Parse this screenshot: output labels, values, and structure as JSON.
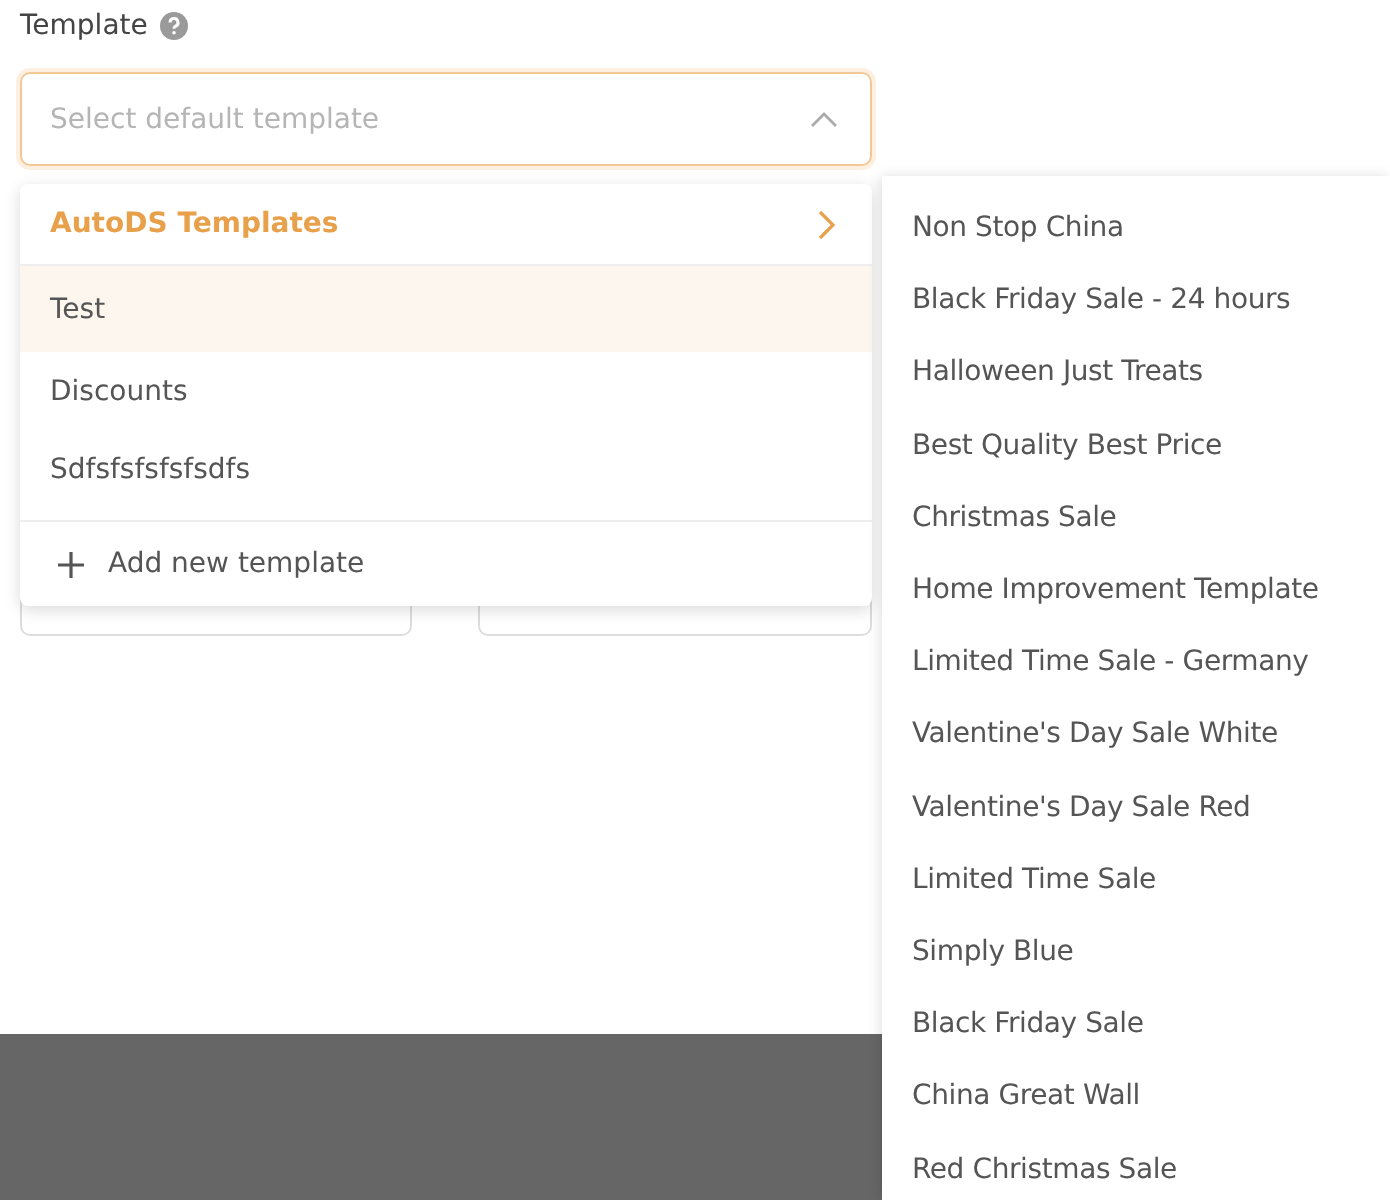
{
  "field": {
    "label": "Template",
    "placeholder": "Select default template",
    "open": true
  },
  "dropdown": {
    "group": {
      "label": "AutoDS Templates",
      "expanded": true
    },
    "items": [
      {
        "label": "Test",
        "selected": true
      },
      {
        "label": "Discounts",
        "selected": false
      },
      {
        "label": "Sdfsfsfsfsfsdfs",
        "selected": false
      }
    ],
    "add_label": "Add new template"
  },
  "submenu": {
    "items": [
      "Non Stop China",
      "Black Friday Sale - 24 hours",
      "Halloween Just Treats",
      "Best Quality Best Price",
      "Christmas Sale",
      "Home Improvement Template",
      "Limited Time Sale - Germany",
      "Valentine's Day Sale White",
      "Valentine's Day Sale Red",
      "Limited Time Sale",
      "Simply Blue",
      "Black Friday Sale",
      "China Great Wall",
      "Red Christmas Sale"
    ]
  }
}
